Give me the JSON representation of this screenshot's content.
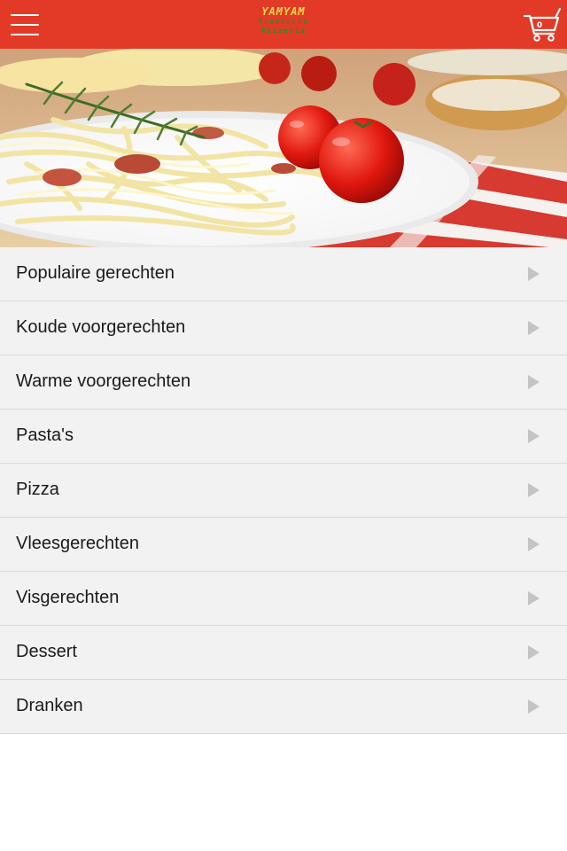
{
  "header": {
    "logo_brand": "YAMYAM",
    "logo_line1": "Trattoria",
    "logo_line2": "Pizzeria",
    "cart_count": "0",
    "menu_icon": "hamburger-menu-icon",
    "cart_icon": "shopping-cart-icon",
    "color": "#e23a26"
  },
  "hero": {
    "image": "pasta-dish-photo"
  },
  "menu": {
    "items": [
      {
        "label": "Populaire gerechten"
      },
      {
        "label": "Koude voorgerechten"
      },
      {
        "label": "Warme voorgerechten"
      },
      {
        "label": "Pasta's"
      },
      {
        "label": "Pizza"
      },
      {
        "label": "Vleesgerechten"
      },
      {
        "label": "Visgerechten"
      },
      {
        "label": "Dessert"
      },
      {
        "label": "Dranken"
      }
    ],
    "arrow_icon": "chevron-right-icon"
  }
}
